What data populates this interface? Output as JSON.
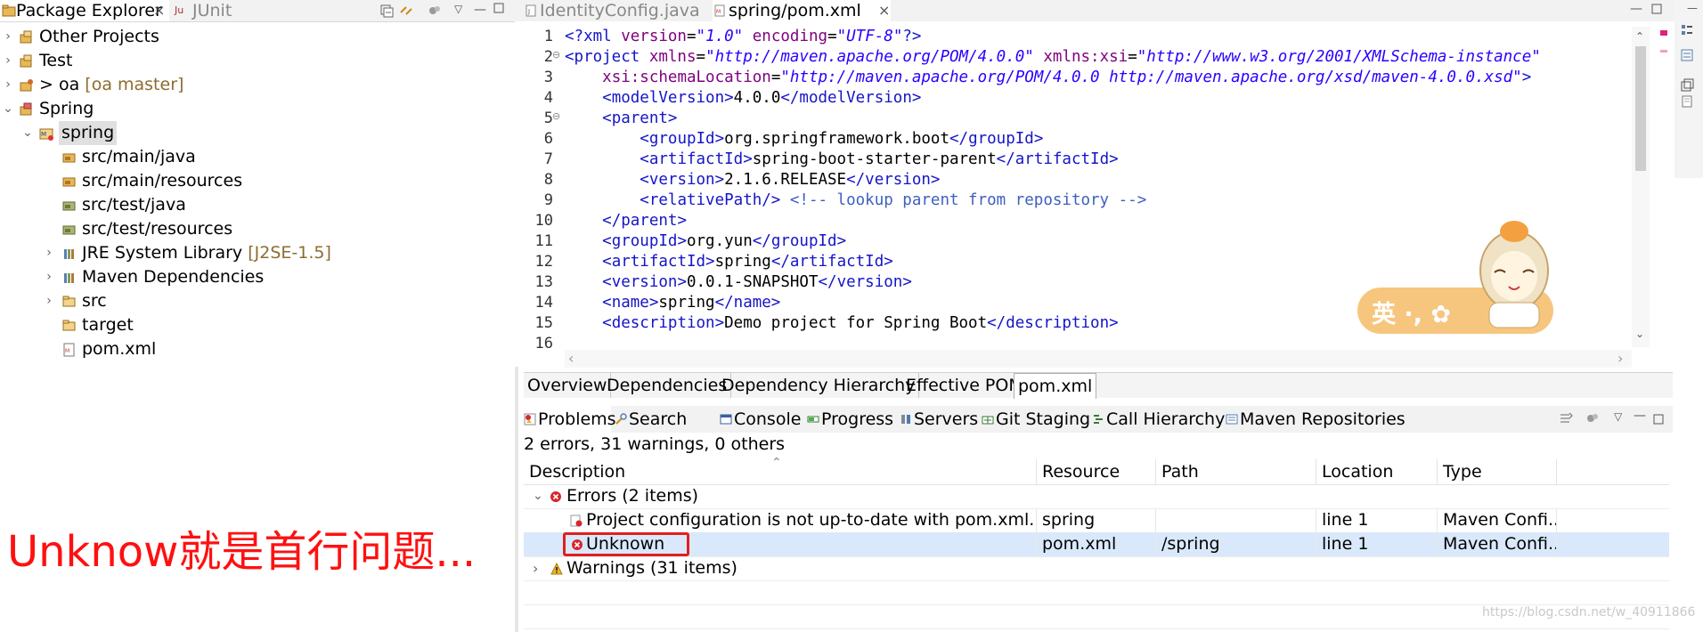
{
  "package_explorer": {
    "tabs": [
      {
        "label": "Package Explorer",
        "close": "×"
      },
      {
        "label": "JUnit"
      }
    ],
    "tree": [
      {
        "label": "Other Projects",
        "decoration": ""
      },
      {
        "label": "Test",
        "decoration": ""
      },
      {
        "label": "> oa",
        "decoration": "[oa master]"
      },
      {
        "label": "Spring",
        "decoration": ""
      },
      {
        "label": "spring",
        "decoration": ""
      },
      {
        "label": "src/main/java",
        "decoration": ""
      },
      {
        "label": "src/main/resources",
        "decoration": ""
      },
      {
        "label": "src/test/java",
        "decoration": ""
      },
      {
        "label": "src/test/resources",
        "decoration": ""
      },
      {
        "label": "JRE System Library",
        "decoration": "[J2SE-1.5]"
      },
      {
        "label": "Maven Dependencies",
        "decoration": ""
      },
      {
        "label": "src",
        "decoration": ""
      },
      {
        "label": "target",
        "decoration": ""
      },
      {
        "label": "pom.xml",
        "decoration": ""
      }
    ]
  },
  "editor": {
    "tabs": [
      {
        "label": "IdentityConfig.java"
      },
      {
        "label": "spring/pom.xml",
        "close": "×"
      }
    ],
    "line_numbers": [
      "1",
      "2",
      "3",
      "4",
      "5",
      "6",
      "7",
      "8",
      "9",
      "10",
      "11",
      "12",
      "13",
      "14",
      "15",
      "16"
    ],
    "bottom_tabs": [
      "Overview",
      "Dependencies",
      "Dependency Hierarchy",
      "Effective POM",
      "pom.xml"
    ],
    "sticker_text": "英 ·, ✿"
  },
  "problems": {
    "tabs": [
      "Problems",
      "Search",
      "Console",
      "Progress",
      "Servers",
      "Git Staging",
      "Call Hierarchy",
      "Maven Repositories"
    ],
    "summary": "2 errors, 31 warnings, 0 others",
    "columns": [
      "Description",
      "Resource",
      "Path",
      "Location",
      "Type"
    ],
    "groups": {
      "errors_label": "Errors (2 items)",
      "warnings_label": "Warnings (31 items)"
    },
    "rows": [
      {
        "description": "Project configuration is not up-to-date with pom.xml. Select",
        "resource": "spring",
        "path": "",
        "location": "line 1",
        "type": "Maven Confi..."
      },
      {
        "description": "Unknown",
        "resource": "pom.xml",
        "path": "/spring",
        "location": "line 1",
        "type": "Maven Confi..."
      }
    ]
  },
  "annotation": "Unknow就是首行问题...",
  "watermark": "https://blog.csdn.net/w_40911866",
  "colors": {
    "xml_tag": "#1515c8",
    "xml_attr": "#7f007f",
    "xml_string": "#2a00ff",
    "xml_comment": "#3f5fbf",
    "annotation_red": "#ff1010",
    "selection": "#d9e9fb"
  }
}
